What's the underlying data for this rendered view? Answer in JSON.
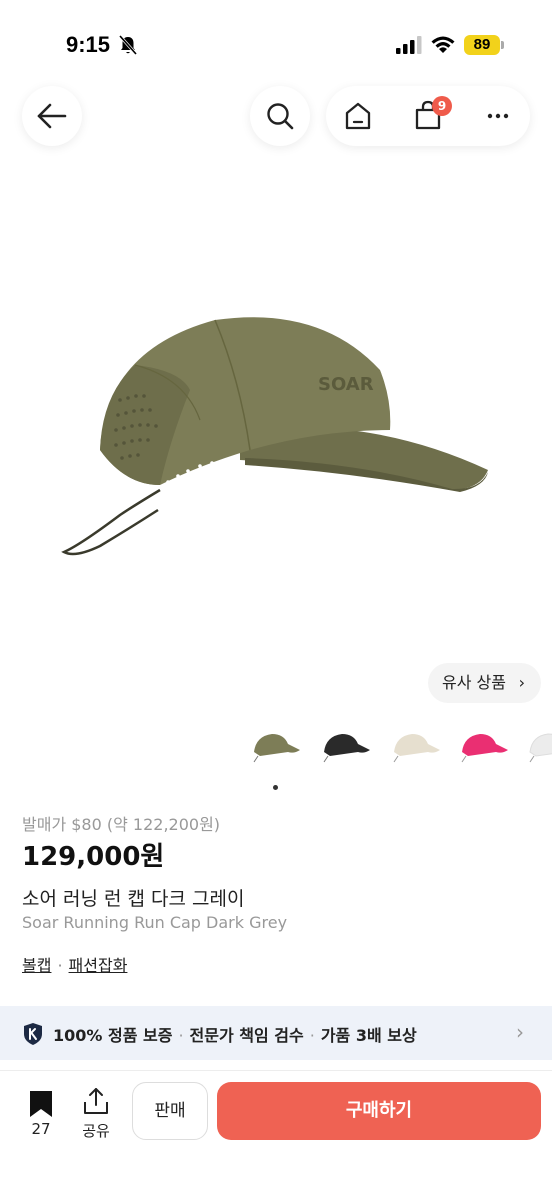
{
  "status_bar": {
    "time": "9:15",
    "battery": "89"
  },
  "nav": {
    "cart_badge": "9"
  },
  "similar": {
    "label": "유사 상품",
    "chevron": "›"
  },
  "thumbnails": [
    {
      "name": "olive",
      "color": "#7d7d57"
    },
    {
      "name": "black",
      "color": "#2a2a2a"
    },
    {
      "name": "beige",
      "color": "#e6dfcf"
    },
    {
      "name": "pink",
      "color": "#ea2f72"
    },
    {
      "name": "white",
      "color": "#ececec"
    }
  ],
  "product": {
    "release_price": "발매가 $80 (약 122,200원)",
    "price": "129,000원",
    "name_ko": "소어 러닝 런 캡 다크 그레이",
    "name_en": "Soar Running Run Cap Dark Grey",
    "category_1": "볼캡",
    "category_sep": "·",
    "category_2": "패션잡화",
    "logo_text": "SOAR"
  },
  "guarantee": {
    "item_1": "100% 정품 보증",
    "item_2": "전문가 책임 검수",
    "item_3": "가품 3배 보상",
    "separator": "·",
    "chevron": "›"
  },
  "bottom": {
    "bookmark_count": "27",
    "share_label": "공유",
    "sell_label": "판매",
    "buy_label": "구매하기"
  },
  "colors": {
    "accent": "#ef6253",
    "badge": "#ef5b4b",
    "battery": "#f2d21b",
    "cap": "#7d7d57"
  }
}
